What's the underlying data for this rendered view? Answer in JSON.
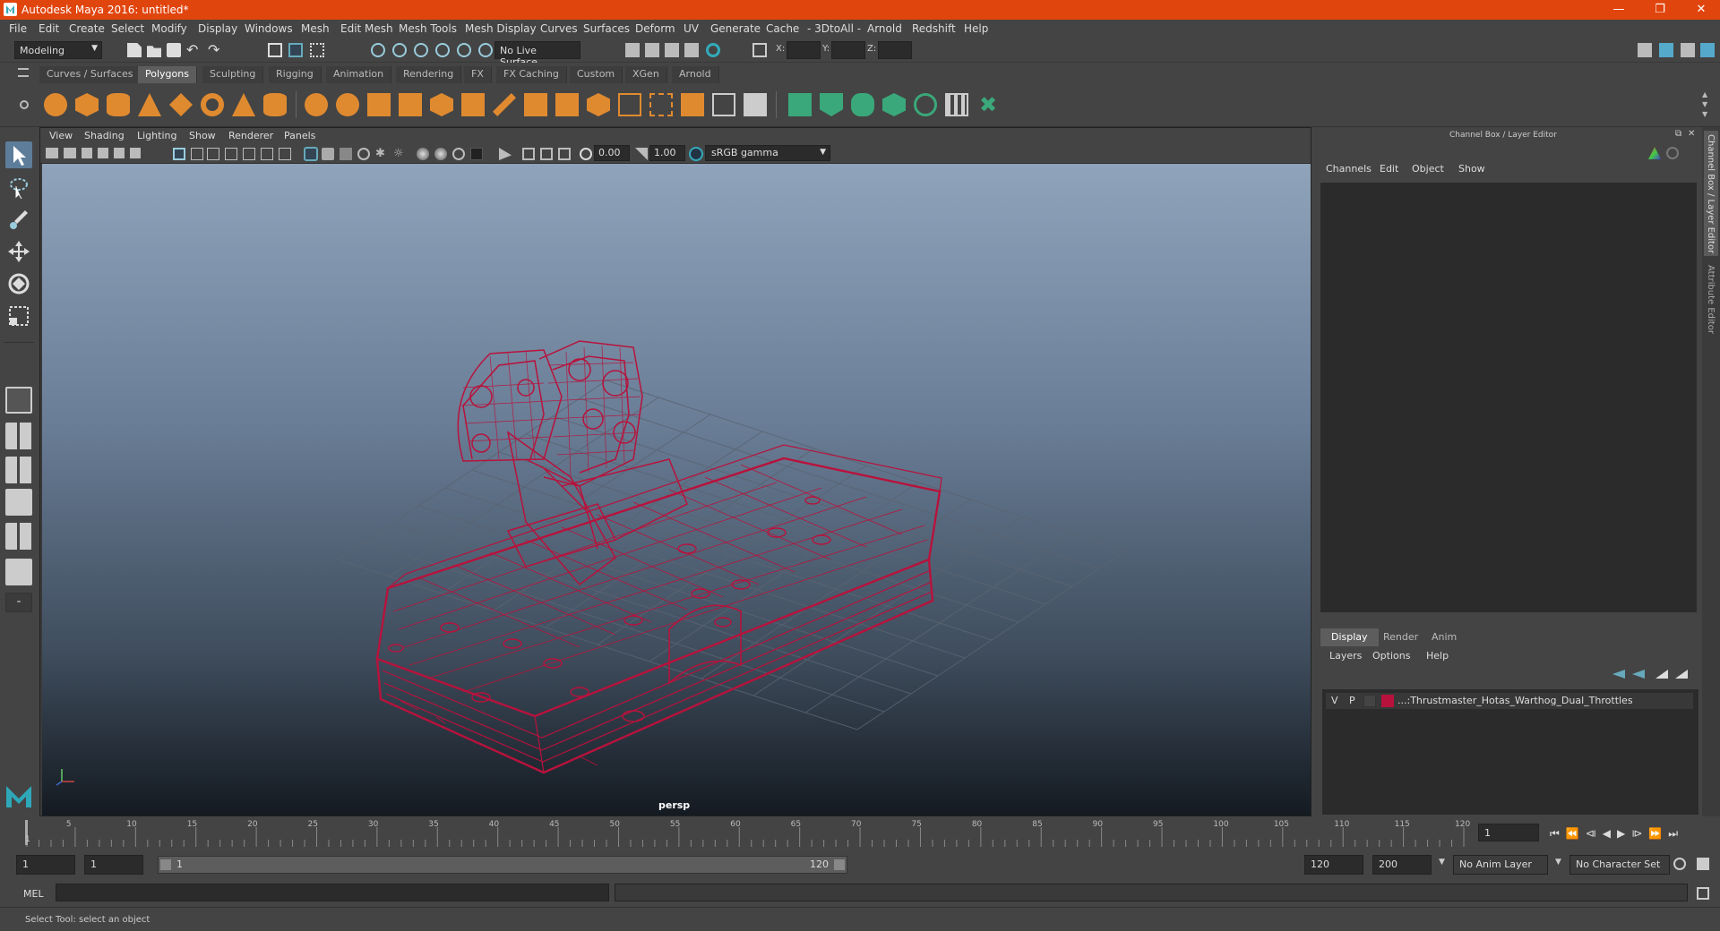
{
  "window": {
    "title": "Autodesk Maya 2016: untitled*"
  },
  "menubar": {
    "items": [
      "File",
      "Edit",
      "Create",
      "Select",
      "Modify",
      "Display",
      "Windows",
      "Mesh",
      "Edit Mesh",
      "Mesh Tools",
      "Mesh Display",
      "Curves",
      "Surfaces",
      "Deform",
      "UV",
      "Generate",
      "Cache",
      "- 3DtoAll -",
      "Arnold",
      "Redshift",
      "Help"
    ]
  },
  "statusline": {
    "mode": "Modeling",
    "live_surface": "No Live Surface",
    "x_label": "X:",
    "y_label": "Y:",
    "z_label": "Z:"
  },
  "shelf": {
    "tabs": [
      "Curves / Surfaces",
      "Polygons",
      "Sculpting",
      "Rigging",
      "Animation",
      "Rendering",
      "FX",
      "FX Caching",
      "Custom",
      "XGen",
      "Arnold"
    ],
    "active_tab": "Polygons"
  },
  "viewport": {
    "menu": [
      "View",
      "Shading",
      "Lighting",
      "Show",
      "Renderer",
      "Panels"
    ],
    "exposure": "0.00",
    "gamma": "1.00",
    "color_space": "sRGB gamma",
    "camera_label": "persp",
    "wire_color": "#b8123c"
  },
  "channel_box": {
    "title": "Channel Box / Layer Editor",
    "menu": [
      "Channels",
      "Edit",
      "Object",
      "Show"
    ]
  },
  "layer_editor": {
    "tabs": [
      "Display",
      "Render",
      "Anim"
    ],
    "active_tab": "Display",
    "menu": [
      "Layers",
      "Options",
      "Help"
    ],
    "layers": [
      {
        "v": "V",
        "p": "P",
        "color": "#b8123c",
        "name": "...:Thrustmaster_Hotas_Warthog_Dual_Throttles"
      }
    ]
  },
  "side_tabs": [
    "Channel Box / Layer Editor",
    "Attribute Editor"
  ],
  "time_slider": {
    "ticks": [
      "5",
      "10",
      "15",
      "20",
      "25",
      "30",
      "35",
      "40",
      "45",
      "50",
      "55",
      "60",
      "65",
      "70",
      "75",
      "80",
      "85",
      "90",
      "95",
      "100",
      "105",
      "110",
      "115",
      "120"
    ],
    "start_marker": "1",
    "current_frame": "1"
  },
  "range_slider": {
    "start": "1",
    "playback_start": "1",
    "bar_start": "1",
    "bar_end": "120",
    "playback_end": "120",
    "end": "200",
    "anim_layer": "No Anim Layer",
    "character_set": "No Character Set"
  },
  "command_line": {
    "label": "MEL"
  },
  "help_line": {
    "text": "Select Tool: select an object"
  }
}
